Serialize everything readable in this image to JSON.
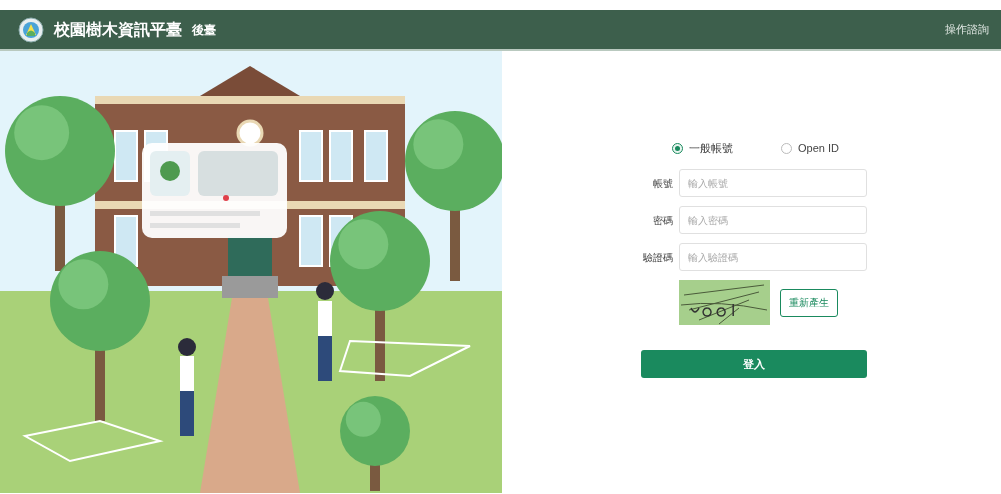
{
  "header": {
    "title": "校園樹木資訊平臺",
    "subtitle": "後臺",
    "help_link": "操作諮詢"
  },
  "login_type": [
    {
      "label": "一般帳號",
      "selected": true
    },
    {
      "label": "Open ID",
      "selected": false
    }
  ],
  "fields": [
    {
      "label": "帳號",
      "placeholder": "輸入帳號"
    },
    {
      "label": "密碼",
      "placeholder": "輸入密碼"
    },
    {
      "label": "驗證碼",
      "placeholder": "輸入驗證碼"
    }
  ],
  "captcha": {
    "refresh_button": "重新產生"
  },
  "login_button": "登入"
}
